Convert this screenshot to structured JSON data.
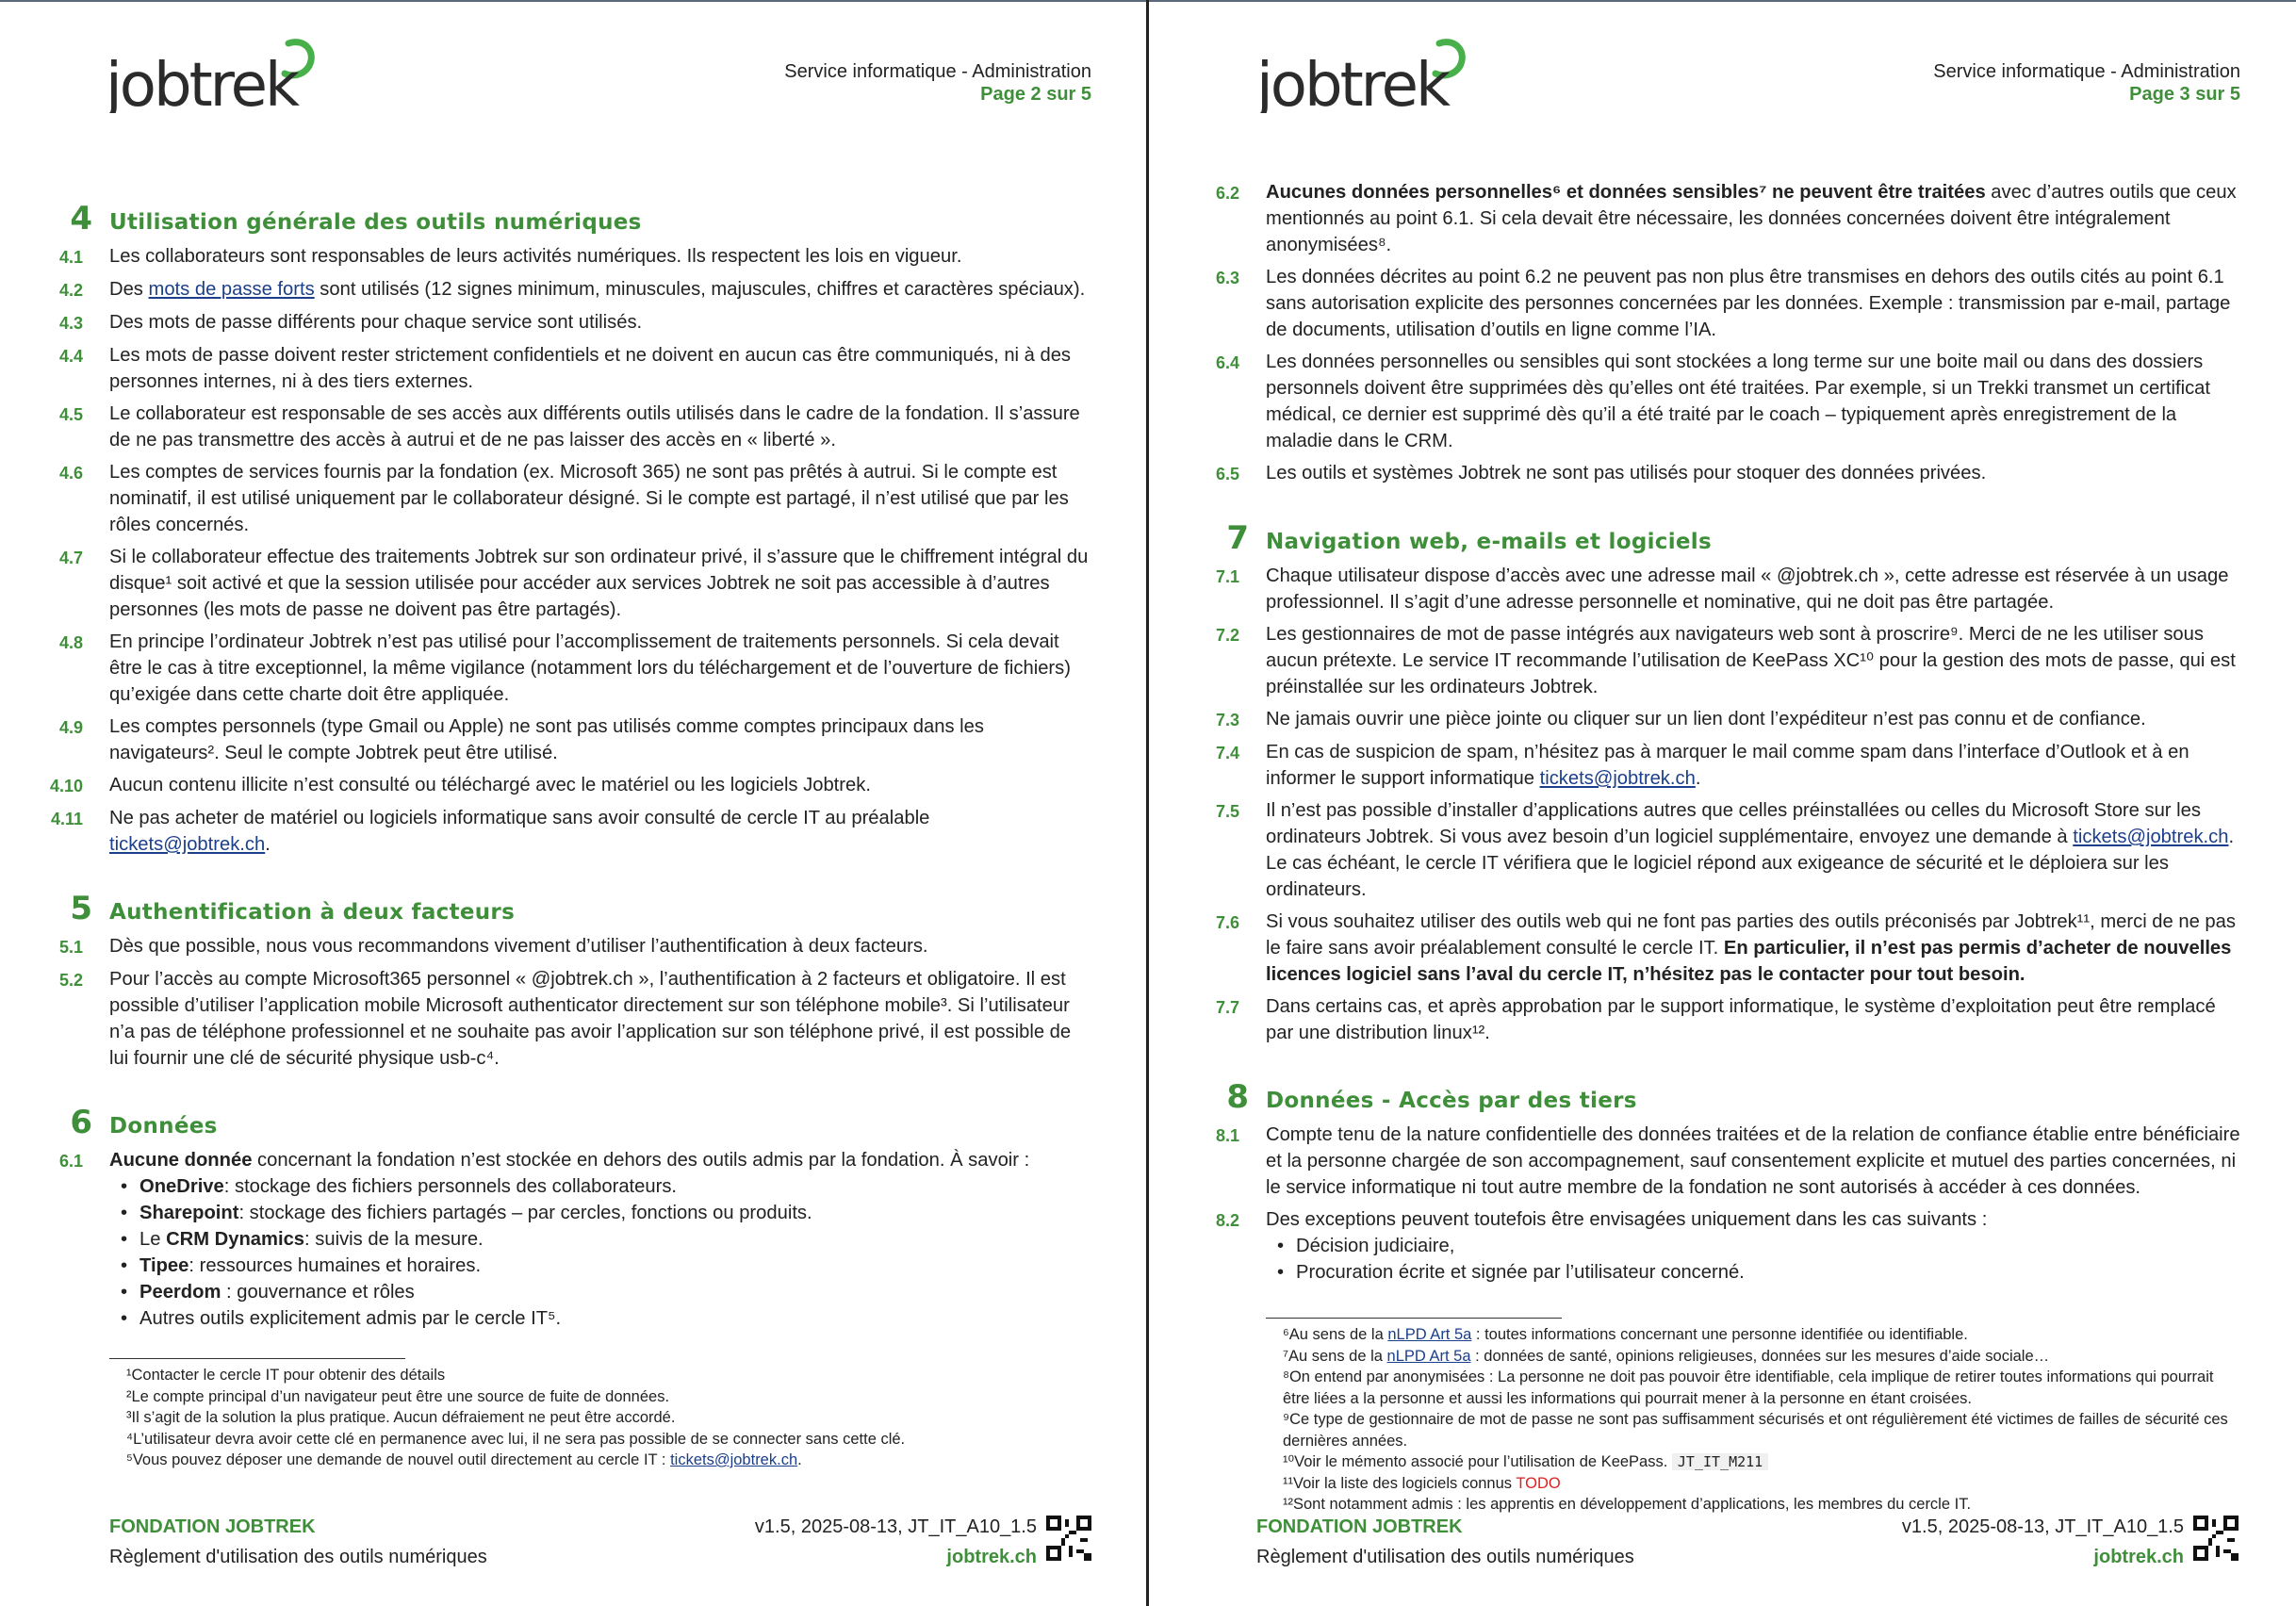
{
  "header": {
    "brand": "jobtrek",
    "service": "Service informatique - Administration"
  },
  "page2": {
    "page_label": "Page 2 sur 5",
    "sec4": {
      "num": "4",
      "title": "Utilisation générale des outils numériques",
      "i1": {
        "n": "4.1",
        "t": "Les collaborateurs sont responsables de leurs activités numériques. Ils respectent les lois en vigueur."
      },
      "i2": {
        "n": "4.2",
        "pre": "Des ",
        "link": "mots de passe forts",
        "post": " sont utilisés (12 signes minimum, minuscules, majuscules, chiffres et caractères spéciaux)."
      },
      "i3": {
        "n": "4.3",
        "t": "Des mots de passe différents pour chaque service sont utilisés."
      },
      "i4": {
        "n": "4.4",
        "t": "Les mots de passe doivent rester strictement confidentiels et ne doivent en aucun cas être communiqués, ni à des personnes internes, ni à des tiers externes."
      },
      "i5": {
        "n": "4.5",
        "t": "Le collaborateur est responsable de ses accès aux différents outils utilisés dans le cadre de la fondation. Il s’assure de ne pas transmettre des accès à autrui et de ne pas laisser des accès en « liberté »."
      },
      "i6": {
        "n": "4.6",
        "t": "Les comptes de services fournis par la fondation (ex. Microsoft 365) ne sont pas prêtés à autrui. Si le compte est nominatif, il est utilisé uniquement par le collaborateur désigné. Si le compte est partagé, il n’est utilisé que par les rôles concernés."
      },
      "i7": {
        "n": "4.7",
        "t": "Si le collaborateur effectue des traitements Jobtrek sur son ordinateur privé, il s’assure que le chiffrement intégral du disque¹ soit activé et que la session utilisée pour accéder aux services Jobtrek ne soit pas accessible à d’autres personnes (les mots de passe ne doivent pas être partagés)."
      },
      "i8": {
        "n": "4.8",
        "t": "En principe l’ordinateur Jobtrek n’est pas utilisé pour l’accomplissement de traitements personnels. Si cela devait être le cas à titre exceptionnel, la même vigilance (notamment lors du téléchargement et de l’ouverture de fichiers) qu’exigée dans cette charte doit être appliquée."
      },
      "i9": {
        "n": "4.9",
        "t": "Les comptes personnels (type Gmail ou Apple) ne sont pas utilisés comme comptes principaux dans les navigateurs². Seul le compte Jobtrek peut être utilisé."
      },
      "i10": {
        "n": "4.10",
        "t": "Aucun contenu illicite n’est consulté ou téléchargé avec le matériel ou les logiciels Jobtrek."
      },
      "i11": {
        "n": "4.11",
        "pre": "Ne pas acheter de matériel ou logiciels informatique sans avoir consulté de cercle IT au préalable ",
        "link": "tickets@jobtrek.ch",
        "post": "."
      }
    },
    "sec5": {
      "num": "5",
      "title": "Authentification à deux facteurs",
      "i1": {
        "n": "5.1",
        "t": "Dès que possible, nous vous recommandons vivement d’utiliser l’authentification à deux facteurs."
      },
      "i2": {
        "n": "5.2",
        "t": "Pour l’accès au compte Microsoft365 personnel « @jobtrek.ch », l’authentification à 2 facteurs et obligatoire. Il est possible d’utiliser l’application mobile Microsoft authenticator directement sur son téléphone mobile³. Si l’utilisateur n’a pas de téléphone professionnel et ne souhaite pas avoir l’application sur son téléphone privé, il est possible de lui fournir une clé de sécurité physique usb-c⁴."
      }
    },
    "sec6": {
      "num": "6",
      "title": "Données",
      "i1": {
        "n": "6.1",
        "bold": "Aucune donnée",
        "post": " concernant la fondation n’est stockée en dehors des outils admis par la fondation. À savoir :"
      },
      "b1": {
        "bold": "OneDrive",
        "post": ": stockage des fichiers personnels des collaborateurs."
      },
      "b2": {
        "bold": "Sharepoint",
        "post": ": stockage des fichiers partagés – par cercles, fonctions ou produits."
      },
      "b3": {
        "pre": "Le ",
        "bold": "CRM Dynamics",
        "post": ": suivis de la mesure."
      },
      "b4": {
        "bold": "Tipee",
        "post": ": ressources humaines et horaires."
      },
      "b5": {
        "bold": "Peerdom",
        "post": " : gouvernance et rôles"
      },
      "b6": {
        "post": "Autres outils explicitement admis par le cercle IT⁵."
      }
    },
    "footnotes": {
      "f1": "¹Contacter le cercle IT pour obtenir des détails",
      "f2": "²Le compte principal d’un navigateur peut être une source de fuite de données.",
      "f3": "³Il s’agit de la solution la plus pratique. Aucun défraiement ne peut être accordé.",
      "f4": "⁴L’utilisateur devra avoir cette clé en permanence avec lui, il ne sera pas possible de se connecter sans cette clé.",
      "f5_pre": "⁵Vous pouvez déposer une demande de nouvel outil directement au cercle IT : ",
      "f5_link": "tickets@jobtrek.ch",
      "f5_post": "."
    }
  },
  "page3": {
    "page_label": "Page 3 sur 5",
    "sec6": {
      "i2": {
        "n": "6.2",
        "bold": "Aucunes données personnelles⁶ et données sensibles⁷ ne peuvent être traitées",
        "post": " avec d’autres outils que ceux mentionnés au point 6.1. Si cela devait être nécessaire, les données concernées doivent être intégralement anonymisées⁸."
      },
      "i3": {
        "n": "6.3",
        "t": "Les données décrites au point 6.2 ne peuvent pas non plus être transmises en dehors des outils cités au point 6.1 sans autorisation explicite des personnes concernées par les données. Exemple : transmission par e-mail, partage de documents, utilisation d’outils en ligne comme l’IA."
      },
      "i4": {
        "n": "6.4",
        "t": "Les données personnelles ou sensibles qui sont stockées a long terme sur une boite mail ou dans des dossiers personnels doivent être supprimées dès qu’elles ont été traitées. Par exemple, si un Trekki transmet un certificat médical, ce dernier est supprimé dès qu’il a été traité par le coach – typiquement après enregistrement de la maladie dans le CRM."
      },
      "i5": {
        "n": "6.5",
        "t": "Les outils et systèmes Jobtrek ne sont pas utilisés pour stoquer des données privées."
      }
    },
    "sec7": {
      "num": "7",
      "title": "Navigation web, e-mails et logiciels",
      "i1": {
        "n": "7.1",
        "t": "Chaque utilisateur dispose d’accès avec une adresse mail « @jobtrek.ch », cette adresse est réservée à un usage professionnel. Il s’agit d’une adresse personnelle et nominative, qui ne doit pas être partagée."
      },
      "i2": {
        "n": "7.2",
        "t": "Les gestionnaires de mot de passe intégrés aux navigateurs web sont à proscrire⁹. Merci de ne les utiliser sous aucun prétexte. Le service IT recommande l’utilisation de KeePass XC¹⁰ pour la gestion des mots de passe, qui est préinstallée sur les ordinateurs Jobtrek."
      },
      "i3": {
        "n": "7.3",
        "t": "Ne jamais ouvrir une pièce jointe ou cliquer sur un lien dont l’expéditeur n’est pas connu et de confiance."
      },
      "i4": {
        "n": "7.4",
        "pre": "En cas de suspicion de spam, n’hésitez pas à marquer le mail comme spam dans l’interface d’Outlook et à en informer le support informatique ",
        "link": "tickets@jobtrek.ch",
        "post": "."
      },
      "i5": {
        "n": "7.5",
        "pre": "Il n’est pas possible d’installer d’applications autres que celles préinstallées ou celles du Microsoft Store sur les ordinateurs Jobtrek. Si vous avez besoin d’un logiciel supplémentaire, envoyez une demande à ",
        "link": "tickets@jobtrek.ch",
        "post": ". Le cas échéant, le cercle IT vérifiera que le logiciel répond aux exigeance de sécurité et le déploiera sur les ordinateurs."
      },
      "i6": {
        "n": "7.6",
        "pre": "Si vous souhaitez utiliser des outils web qui ne font pas parties des outils préconisés par Jobtrek¹¹, merci de ne pas le faire sans avoir préalablement consulté le cercle IT. ",
        "bold": "En particulier, il n’est pas permis d’acheter de nouvelles licences logiciel sans l’aval du cercle IT, n’hésitez pas le contacter pour tout besoin."
      },
      "i7": {
        "n": "7.7",
        "t": "Dans certains cas, et après approbation par le support informatique, le système d’exploitation peut être remplacé par une distribution linux¹²."
      }
    },
    "sec8": {
      "num": "8",
      "title": "Données - Accès par des tiers",
      "i1": {
        "n": "8.1",
        "t": "Compte tenu de la nature confidentielle des données traitées et de la relation de confiance établie entre bénéficiaire et la personne chargée de son accompagnement, sauf consentement explicite et mutuel des parties concernées, ni le service informatique ni tout autre membre de la fondation ne sont autorisés à accéder à ces données."
      },
      "i2": {
        "n": "8.2",
        "t": "Des exceptions peuvent toutefois être envisagées uniquement dans les cas suivants :"
      },
      "b1": "Décision judiciaire,",
      "b2": "Procuration écrite et signée par l’utilisateur concerné."
    },
    "footnotes": {
      "f6_pre": "⁶Au sens de la ",
      "f6_link": "nLPD Art 5a",
      "f6_post": " : toutes informations concernant une personne identifiée ou identifiable.",
      "f7_pre": "⁷Au sens de la ",
      "f7_link": "nLPD Art 5a",
      "f7_post": " : données de santé, opinions religieuses, données sur les mesures d’aide sociale…",
      "f8": "⁸On entend par anonymisées : La personne ne doit pas pouvoir être identifiable, cela implique de retirer toutes informations qui pourrait être liées a la personne et aussi les informations qui pourrait mener à la personne en étant croisées.",
      "f9": "⁹Ce type de gestionnaire de mot de passe ne sont pas suffisamment sécurisés et ont régulièrement été victimes de failles de sécurité ces dernières années.",
      "f10_pre": "¹⁰Voir le mémento associé pour l’utilisation de KeePass. ",
      "f10_code": "JT_IT_M211",
      "f11_pre": "¹¹Voir la liste des logiciels connus ",
      "f11_todo": "TODO",
      "f12": "¹²Sont notamment admis : les apprentis en développement d’applications, les membres du cercle IT."
    }
  },
  "footer": {
    "org": "FONDATION JOBTREK",
    "doc_title": "Règlement d'utilisation des outils numériques",
    "version": "v1.5, 2025-08-13, JT_IT_A10_1.5",
    "website": "jobtrek.ch"
  },
  "colors": {
    "accent": "#3f8f3a",
    "link": "#1b3f8b",
    "text": "#222222"
  }
}
